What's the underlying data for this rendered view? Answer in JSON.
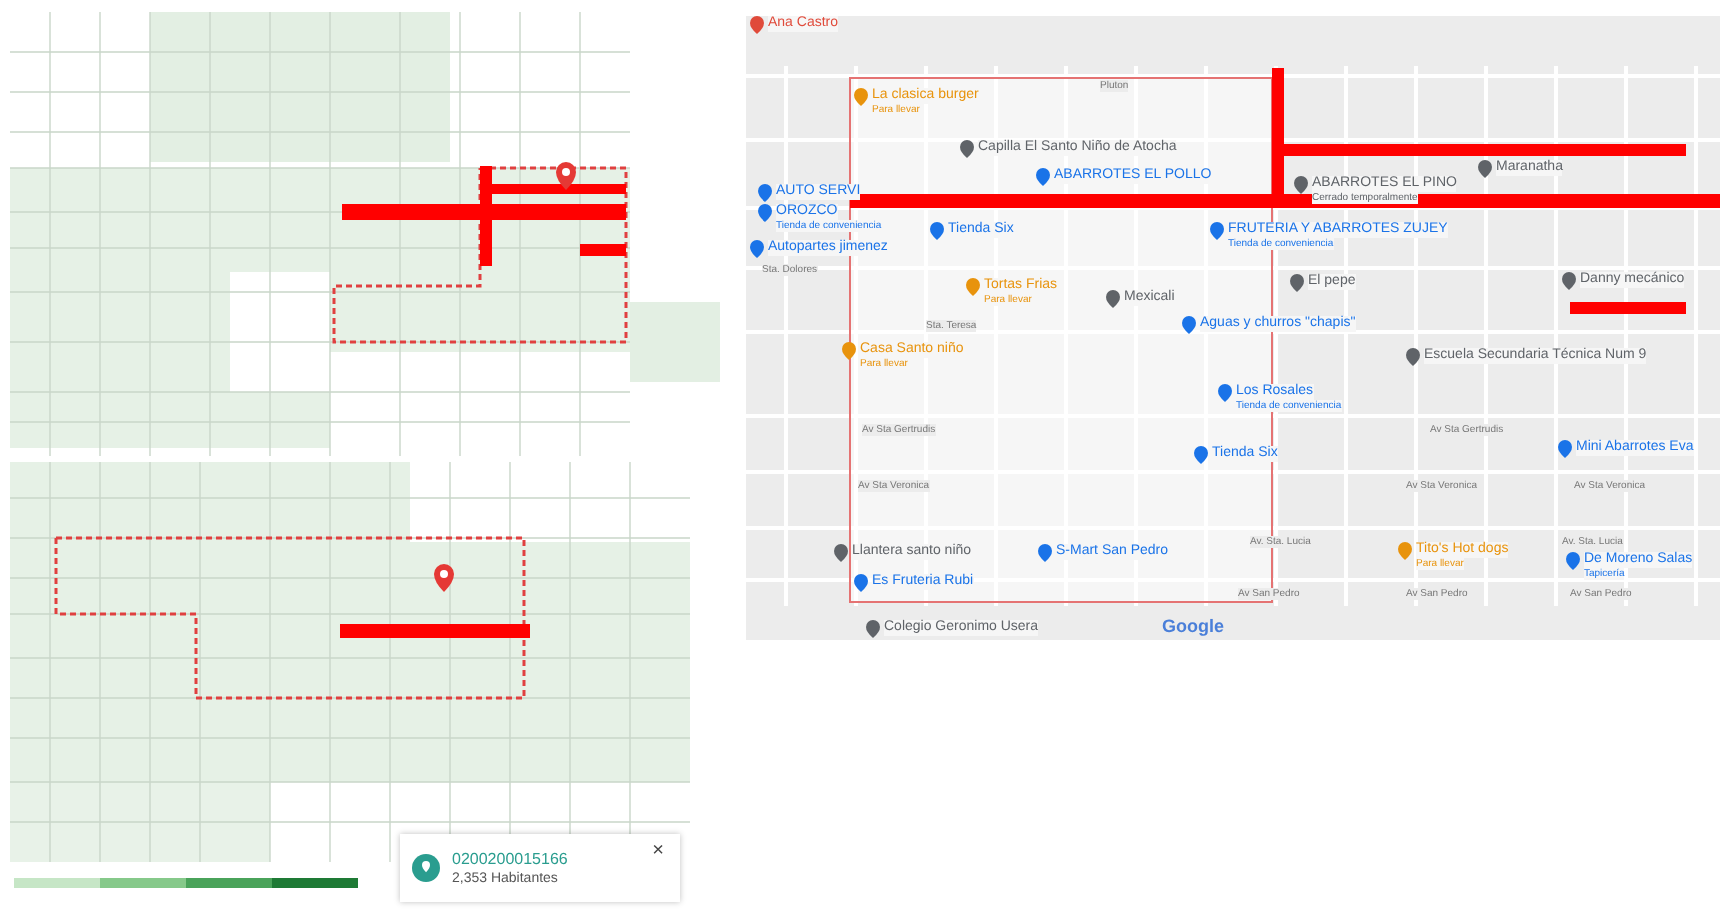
{
  "population_map_top": {
    "has_pin": true
  },
  "population_map_bottom": {
    "has_pin": true,
    "info_card": {
      "code": "0200200015166",
      "population": "2,353 Habitantes",
      "close": "×"
    }
  },
  "google_map": {
    "labels": [
      {
        "kind": "place",
        "text": "Ana Castro",
        "color": "#e04a3a"
      },
      {
        "kind": "street",
        "text": "Pluton"
      },
      {
        "kind": "place",
        "text": "La clasica burger",
        "sub": "Para llevar",
        "color": "#e8930c"
      },
      {
        "kind": "place",
        "text": "Capilla El Santo Niño de Atocha",
        "color": "#5f6368"
      },
      {
        "kind": "place",
        "text": "Maranatha",
        "color": "#5f6368"
      },
      {
        "kind": "place",
        "text": "AUTO SERVI",
        "color": "#1a73e8"
      },
      {
        "kind": "place",
        "text": "ABARROTES EL POLLO",
        "color": "#1a73e8"
      },
      {
        "kind": "place",
        "text": "ABARROTES EL PINO",
        "sub": "Cerrado temporalmente",
        "color": "#5f6368"
      },
      {
        "kind": "place",
        "text": "OROZCO",
        "sub": "Tienda de conveniencia",
        "color": "#1a73e8"
      },
      {
        "kind": "place",
        "text": "Tienda Six",
        "color": "#1a73e8"
      },
      {
        "kind": "place",
        "text": "FRUTERIA Y ABARROTES ZUJEY",
        "sub": "Tienda de conveniencia",
        "color": "#1a73e8"
      },
      {
        "kind": "place",
        "text": "Autopartes jimenez",
        "color": "#1a73e8"
      },
      {
        "kind": "street",
        "text": "Sta. Dolores"
      },
      {
        "kind": "place",
        "text": "Tortas Frias",
        "sub": "Para llevar",
        "color": "#e8930c"
      },
      {
        "kind": "place",
        "text": "Mexicali",
        "color": "#5f6368"
      },
      {
        "kind": "place",
        "text": "El pepe",
        "color": "#5f6368"
      },
      {
        "kind": "place",
        "text": "Danny mecánico",
        "color": "#5f6368"
      },
      {
        "kind": "street",
        "text": "Sta. Teresa"
      },
      {
        "kind": "place",
        "text": "Aguas y churros \"chapis\"",
        "color": "#1a73e8"
      },
      {
        "kind": "place",
        "text": "Casa Santo niño",
        "sub": "Para llevar",
        "color": "#e8930c"
      },
      {
        "kind": "place",
        "text": "Escuela Secundaria Técnica Num 9",
        "color": "#5f6368"
      },
      {
        "kind": "place",
        "text": "Los Rosales",
        "sub": "Tienda de conveniencia",
        "color": "#1a73e8"
      },
      {
        "kind": "street",
        "text": "Av Sta Gertrudis"
      },
      {
        "kind": "street",
        "text": "Av Sta Gertrudis"
      },
      {
        "kind": "place",
        "text": "Mini Abarrotes Eva",
        "color": "#1a73e8"
      },
      {
        "kind": "place",
        "text": "Tienda Six",
        "color": "#1a73e8"
      },
      {
        "kind": "street",
        "text": "Av Sta Veronica"
      },
      {
        "kind": "street",
        "text": "Av Sta Veronica"
      },
      {
        "kind": "street",
        "text": "Av Sta Veronica"
      },
      {
        "kind": "place",
        "text": "Llantera santo niño",
        "color": "#5f6368"
      },
      {
        "kind": "place",
        "text": "S-Mart San Pedro",
        "color": "#1a73e8"
      },
      {
        "kind": "street",
        "text": "Av. Sta. Lucia"
      },
      {
        "kind": "place",
        "text": "Tito's Hot dogs",
        "sub": "Para llevar",
        "color": "#e8930c"
      },
      {
        "kind": "street",
        "text": "Av. Sta. Lucia"
      },
      {
        "kind": "place",
        "text": "De Moreno Salas",
        "sub": "Tapicería",
        "color": "#1a73e8"
      },
      {
        "kind": "place",
        "text": "Es Fruteria Rubi",
        "color": "#1a73e8"
      },
      {
        "kind": "street",
        "text": "Av San Pedro"
      },
      {
        "kind": "street",
        "text": "Av San Pedro"
      },
      {
        "kind": "street",
        "text": "Av San Pedro"
      },
      {
        "kind": "place",
        "text": "Colegio Geronimo Usera",
        "color": "#5f6368"
      }
    ],
    "logo": "Google"
  }
}
